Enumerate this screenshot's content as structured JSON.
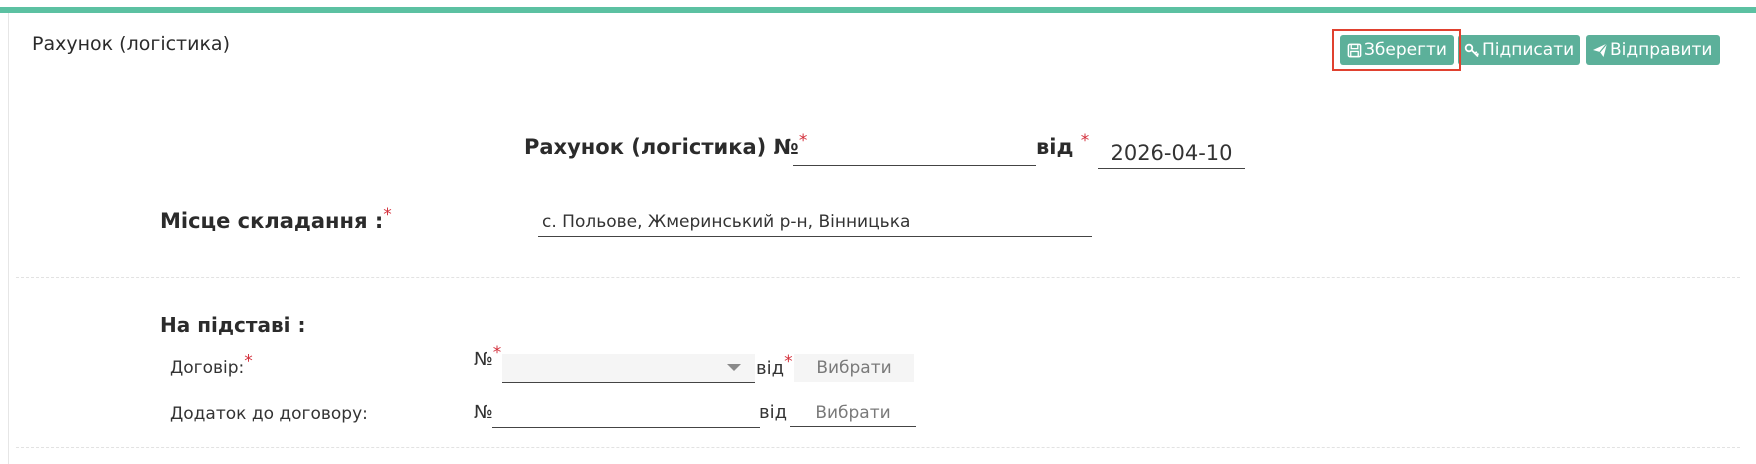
{
  "panel": {
    "title": "Рахунок (логістика)"
  },
  "toolbar": {
    "save_label": "Зберегти",
    "sign_label": "Підписати",
    "send_label": "Відправити"
  },
  "form": {
    "heading": "Рахунок (логістика) №",
    "required_mark": "*",
    "number_value": "",
    "from_label": "від",
    "date_value": "2026-04-10",
    "place_label": "Місце складання :",
    "place_value": "с. Польове, Жмеринський р-н, Вінницька",
    "basis_label": "На підставі :",
    "contract": {
      "label": "Договір:",
      "number_sign": "№",
      "selected": "",
      "from_label": "від",
      "date_placeholder": "Вибрати"
    },
    "addendum": {
      "label": "Додаток до договору:",
      "number_sign": "№",
      "number_value": "",
      "from_label": "від",
      "date_placeholder": "Вибрати"
    }
  },
  "colors": {
    "accent": "#5cc1a2",
    "button": "#5cb09a",
    "required": "#d32f3b",
    "highlight": "#e0412f"
  },
  "icons": {
    "save": "floppy-disk-icon",
    "sign": "key-icon",
    "send": "paper-plane-icon"
  }
}
